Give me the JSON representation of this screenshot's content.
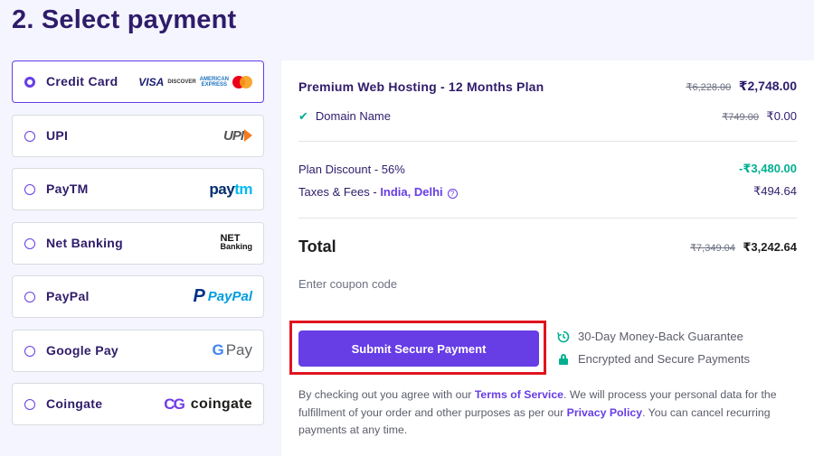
{
  "page": {
    "title": "2. Select payment"
  },
  "colors": {
    "accent": "#673de6",
    "success": "#00b090",
    "highlight": "#e0141e",
    "heading": "#2f1c6a"
  },
  "methods": [
    {
      "label": "Credit Card",
      "selected": true,
      "logo": "visa-discover-amex-mastercard-logos"
    },
    {
      "label": "UPI",
      "selected": false,
      "logo": "upi-logo"
    },
    {
      "label": "PayTM",
      "selected": false,
      "logo": "paytm-logo"
    },
    {
      "label": "Net Banking",
      "selected": false,
      "logo": "net-banking-logo"
    },
    {
      "label": "PayPal",
      "selected": false,
      "logo": "paypal-logo"
    },
    {
      "label": "Google Pay",
      "selected": false,
      "logo": "google-pay-logo"
    },
    {
      "label": "Coingate",
      "selected": false,
      "logo": "coingate-logo"
    }
  ],
  "logos": {
    "visa": "VISA",
    "discover": "DISCOVER",
    "amex_1": "AMERICAN",
    "amex_2": "EXPRESS",
    "upi": "UPI",
    "paytm_1": "pay",
    "paytm_2": "tm",
    "netbank_1": "NET",
    "netbank_2": "Banking",
    "paypal_mark": "P",
    "paypal_1": "Pay",
    "paypal_2": "Pal",
    "gpay_g": "G",
    "gpay": "Pay",
    "coingate_mark": "CG",
    "coingate": "coingate"
  },
  "summary": {
    "plan": {
      "name": "Premium Web Hosting - 12 Months Plan",
      "old_price": "₹6,228.00",
      "price": "₹2,748.00"
    },
    "domain": {
      "name": "Domain Name",
      "old_price": "₹749.00",
      "price": "₹0.00"
    },
    "discount": {
      "label": "Plan Discount - 56%",
      "value": "-₹3,480.00"
    },
    "taxes": {
      "label": "Taxes & Fees - ",
      "location": "India, Delhi",
      "value": "₹494.64"
    },
    "total": {
      "label": "Total",
      "old_price": "₹7,349.04",
      "price": "₹3,242.64"
    }
  },
  "coupon": {
    "placeholder": "Enter coupon code",
    "value": ""
  },
  "submit": {
    "label": "Submit Secure Payment"
  },
  "guarantees": [
    {
      "icon": "money-back-icon",
      "text": "30-Day Money-Back Guarantee"
    },
    {
      "icon": "lock-icon",
      "text": "Encrypted and Secure Payments"
    }
  ],
  "legal": {
    "part1": "By checking out you agree with our ",
    "tos": "Terms of Service",
    "part2": ". We will process your personal data for the fulfillment of your order and other purposes as per our ",
    "privacy": "Privacy Policy",
    "part3": ". You can cancel recurring payments at any time."
  }
}
